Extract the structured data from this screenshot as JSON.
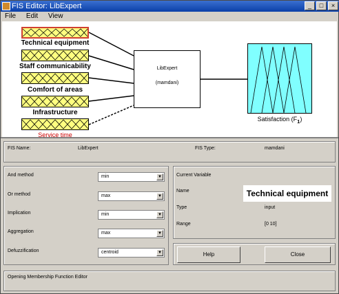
{
  "window": {
    "title": "FIS Editor: LibExpert"
  },
  "menu": [
    "File",
    "Edit",
    "View"
  ],
  "inputs": [
    {
      "label": "Technical equipment",
      "selected": true
    },
    {
      "label": "Staff communicability",
      "selected": false
    },
    {
      "label": "Comfort of areas",
      "selected": false
    },
    {
      "label": "Infrastructure",
      "selected": false
    },
    {
      "label": "Service time",
      "selected": false
    }
  ],
  "system": {
    "name": "LibExpert",
    "type": "(mamdani)"
  },
  "output": {
    "label": "Satisfaction (F",
    "subscript": "1",
    "suffix": ")"
  },
  "info": {
    "fis_name_label": "FIS Name:",
    "fis_name": "LibExpert",
    "fis_type_label": "FIS Type:",
    "fis_type": "mamdani"
  },
  "methods": [
    {
      "label": "And method",
      "value": "min"
    },
    {
      "label": "Or method",
      "value": "max"
    },
    {
      "label": "Implication",
      "value": "min"
    },
    {
      "label": "Aggregation",
      "value": "max"
    },
    {
      "label": "Defuzzification",
      "value": "centroid"
    }
  ],
  "current": {
    "title": "Current Variable",
    "name_label": "Name",
    "name": "Technical equipment",
    "type_label": "Type",
    "type": "input",
    "range_label": "Range",
    "range": "[0 10]"
  },
  "buttons": {
    "help": "Help",
    "close": "Close"
  },
  "status": "Opening Membership Function Editor",
  "colors": {
    "input_fill": "#ffff80",
    "output_fill": "#80ffff",
    "selected_border": "#d04030"
  }
}
